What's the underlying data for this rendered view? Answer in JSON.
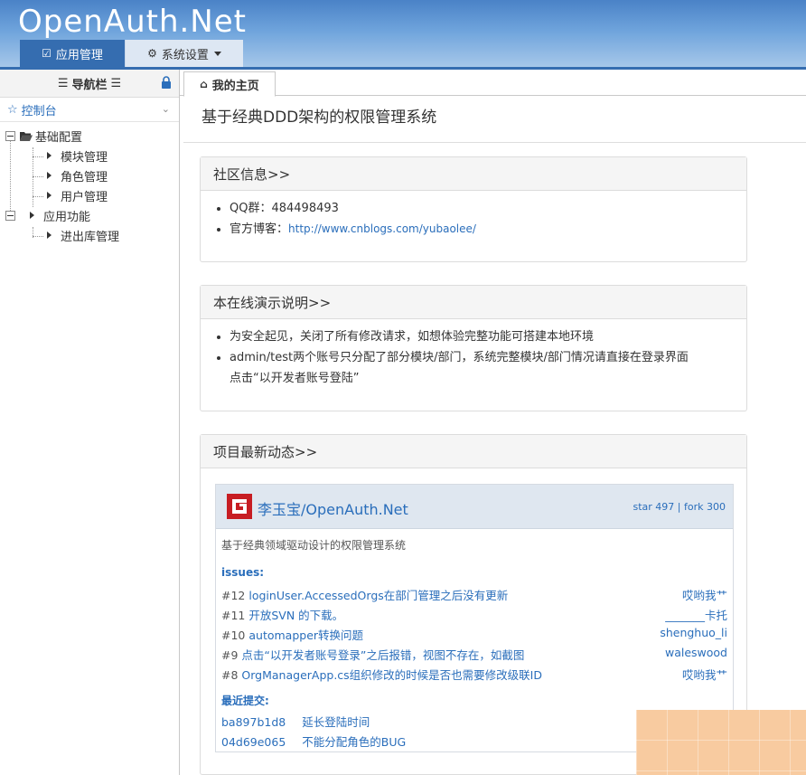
{
  "app": {
    "logo": "OpenAuth.Net"
  },
  "topnav": [
    {
      "label": "应用管理",
      "icon": "check-square-icon"
    },
    {
      "label": "系统设置",
      "icon": "gear-icon"
    }
  ],
  "sidebar": {
    "title": "导航栏",
    "dashboard": "控制台",
    "tree": [
      {
        "label": "基础配置"
      },
      {
        "label": "模块管理"
      },
      {
        "label": "角色管理"
      },
      {
        "label": "用户管理"
      },
      {
        "label": "应用功能"
      },
      {
        "label": "进出库管理"
      }
    ]
  },
  "main": {
    "tab": "我的主页",
    "title": "基于经典DDD架构的权限管理系统",
    "community": {
      "title": "社区信息>>",
      "qq_label": "QQ群：484498493",
      "blog_label": "官方博客：",
      "blog_url": "http://www.cnblogs.com/yubaolee/"
    },
    "demo": {
      "title": "本在线演示说明>>",
      "items": [
        "为安全起见，关闭了所有修改请求，如想体验完整功能可搭建本地环境",
        "admin/test两个账号只分配了部分模块/部门，系统完整模块/部门情况请直接在登录界面",
        "点击“以开发者账号登陆”"
      ]
    },
    "news": {
      "title": "项目最新动态>>",
      "repo": "李玉宝/OpenAuth.Net",
      "stars": "star 497 | fork 300",
      "desc": "基于经典领域驱动设计的权限管理系统",
      "issues_label": "issues:",
      "issues": [
        {
          "num": "#12",
          "title": "loginUser.AccessedOrgs在部门管理之后没有更新",
          "user": "哎哟我艹"
        },
        {
          "num": "#11",
          "title": "开放SVN 的下载。",
          "user": "_______卡托"
        },
        {
          "num": "#10",
          "title": "automapper转换问题",
          "user": "shenghuo_li"
        },
        {
          "num": "#9",
          "title": "点击“以开发者账号登录”之后报错，视图不存在，如截图",
          "user": "waleswood"
        },
        {
          "num": "#8",
          "title": "OrgManagerApp.cs组织修改的时候是否也需要修改级联ID",
          "user": "哎哟我艹"
        }
      ],
      "commits_label": "最近提交:",
      "commits": [
        {
          "hash": "ba897b1d8",
          "msg": "延长登陆时间"
        },
        {
          "hash": "04d69e065",
          "msg": "不能分配角色的BUG"
        }
      ]
    }
  },
  "colors": {
    "brand": "#356db0",
    "link": "#2a6ebb",
    "header_light": "#a9c9ea"
  }
}
